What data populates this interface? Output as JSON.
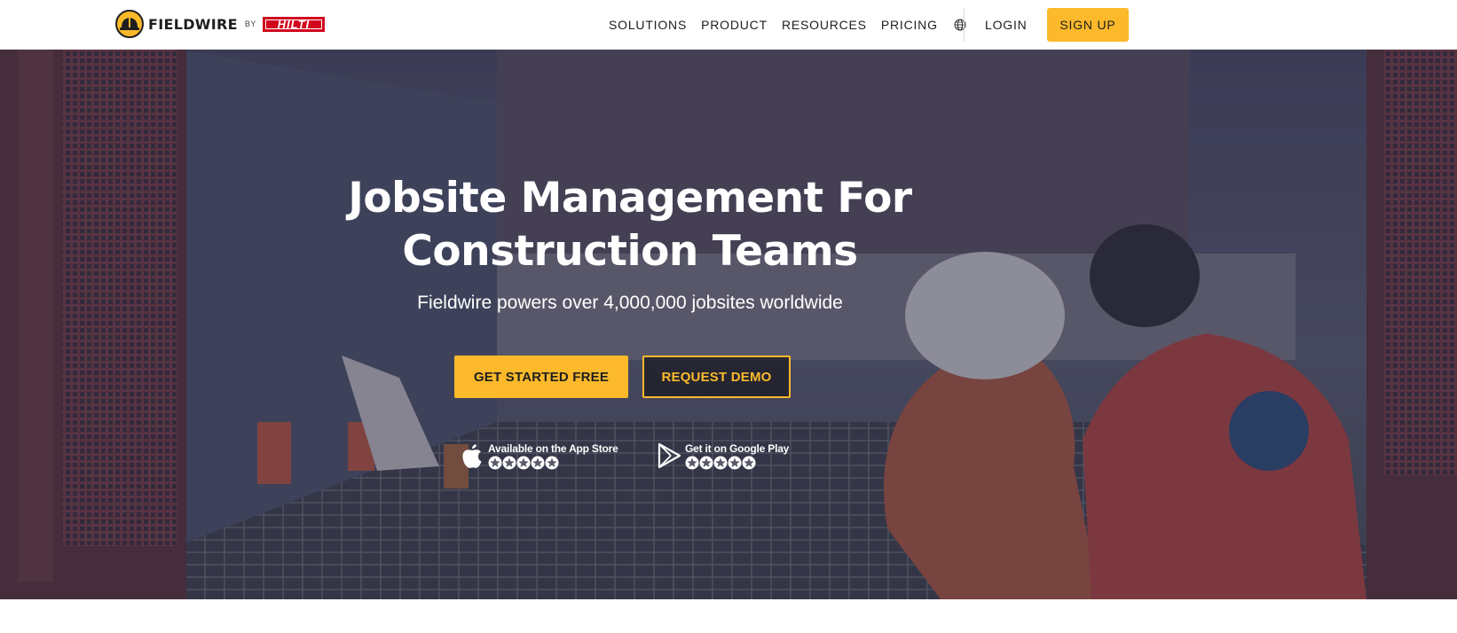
{
  "brand": {
    "name": "FIELDWIRE",
    "by": "BY",
    "partner": "HILTI"
  },
  "nav": {
    "items": [
      "SOLUTIONS",
      "PRODUCT",
      "RESOURCES",
      "PRICING"
    ],
    "language_icon": "globe-icon",
    "login": "LOGIN",
    "signup": "SIGN UP"
  },
  "hero": {
    "headline_line1": "Jobsite Management For",
    "headline_line2": "Construction Teams",
    "subhead": "Fieldwire powers over 4,000,000 jobsites worldwide",
    "cta_primary": "GET STARTED FREE",
    "cta_secondary": "REQUEST DEMO",
    "stores": [
      {
        "label": "Available on the App Store",
        "icon": "apple-icon",
        "rating_stars": 5
      },
      {
        "label": "Get it on Google Play",
        "icon": "google-play-icon",
        "rating_stars": 5
      }
    ]
  },
  "colors": {
    "accent": "#fbb92b",
    "partner_red": "#d2051e",
    "text_dark": "#1e1e1e"
  }
}
